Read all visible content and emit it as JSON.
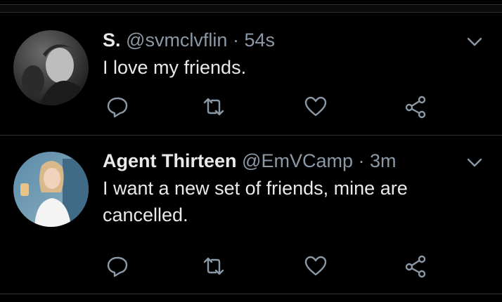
{
  "colors": {
    "background": "#000000",
    "primary_text": "#e7e9ea",
    "secondary_text": "#8b98a5",
    "divider": "#2f3336"
  },
  "tweets": [
    {
      "display_name": "S.",
      "handle": "@svmclvflin",
      "separator": "·",
      "time": "54s",
      "text": "I love my friends.",
      "icons": [
        "avatar-photo",
        "chevron-down-icon",
        "reply-icon",
        "retweet-icon",
        "like-heart-icon",
        "share-icon"
      ]
    },
    {
      "display_name": "Agent Thirteen",
      "handle": "@EmVCamp",
      "separator": "·",
      "time": "3m",
      "text": "I want a new set of friends, mine are cancelled.",
      "icons": [
        "avatar-photo",
        "chevron-down-icon",
        "reply-icon",
        "retweet-icon",
        "like-heart-icon",
        "share-icon"
      ]
    }
  ]
}
